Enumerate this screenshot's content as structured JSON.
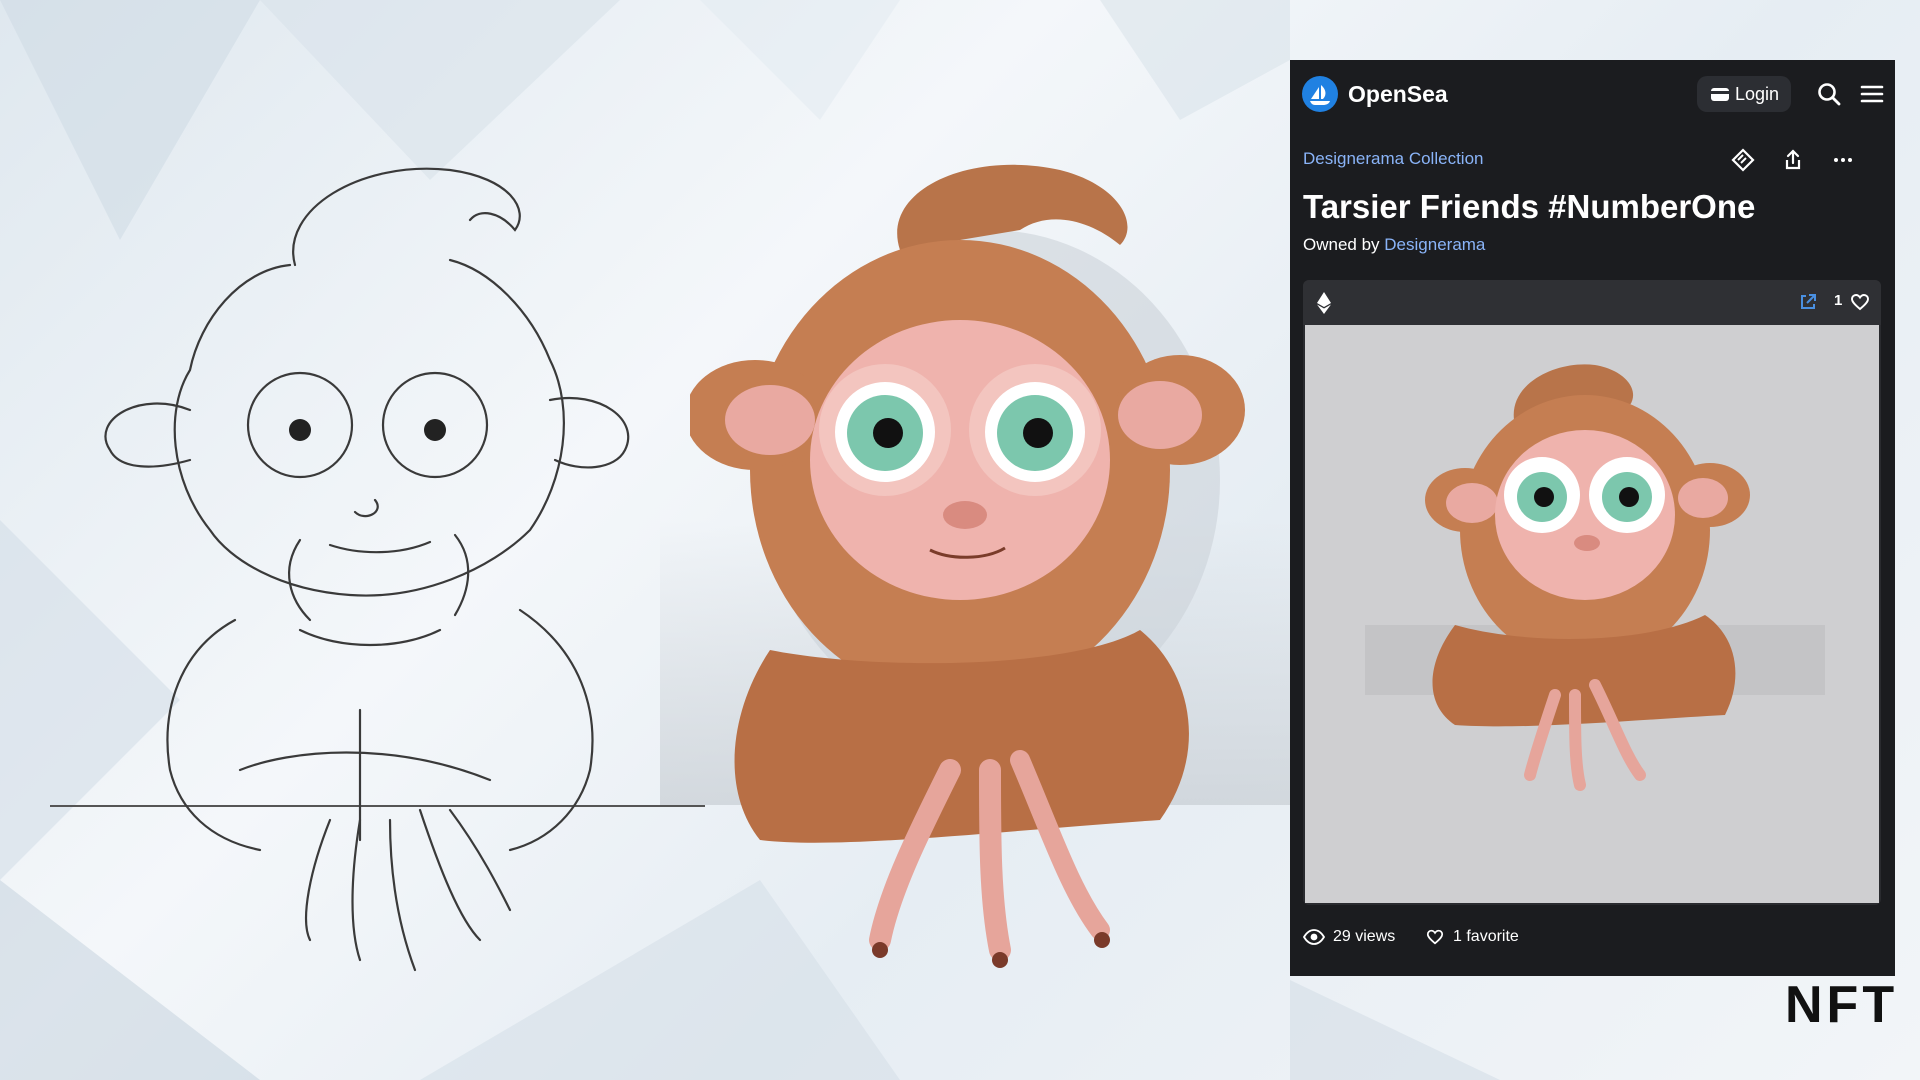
{
  "panel": {
    "brand": "OpenSea",
    "login_label": "Login",
    "collection": "Designerama Collection",
    "title": "Tarsier Friends #NumberOne",
    "owned_by_prefix": "Owned by",
    "owner": "Designerama",
    "favorite_count": "1",
    "views": "29 views",
    "favorites": "1 favorite",
    "icons": [
      "opensea-logo-icon",
      "wallet-icon",
      "search-icon",
      "menu-icon",
      "offer-tag-icon",
      "share-icon",
      "more-icon",
      "ethereum-icon",
      "external-link-icon",
      "heart-icon",
      "eye-icon"
    ],
    "colors": {
      "panel_bg": "#1b1c1f",
      "link": "#8ab4f8",
      "brand_blue": "#2081e2"
    }
  },
  "caption": "NFT"
}
